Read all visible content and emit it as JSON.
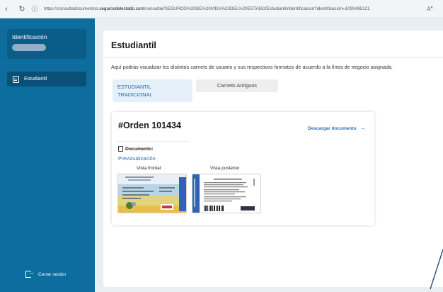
{
  "browser": {
    "url_prefix": "https://consultadocumentos.",
    "url_domain": "segurosdelestado.com",
    "url_path": "/consultar/SEGUROS%20DE%20VIDA%20DEL%20ESTADO/Estudiantil/identificacion?identificacion=1090485121"
  },
  "sidebar": {
    "identification_title": "Identificación",
    "items": [
      {
        "label": "Estudiantil"
      }
    ],
    "logout_label": "Cerrar sesión"
  },
  "main": {
    "title": "Estudiantil",
    "description": "Aquí podrás visualizar los distintos carnets de usuario y sus respectivos formatos de acuerdo a la línea de negocio asignada.",
    "tabs": [
      {
        "label_line1": "ESTUDIANTIL",
        "label_line2": "TRADICIONAL",
        "active": true
      },
      {
        "label": "Carnets Antiguos",
        "active": false
      }
    ],
    "order": {
      "number": "#Orden 101434",
      "download_label": "Descargar documento",
      "document_label": "Documento:",
      "preview_label": "Previzualización",
      "front_caption": "Vista frontal",
      "back_caption": "Vista posterior"
    }
  },
  "colors": {
    "sidebar": "#0c6d9e",
    "sidebar_active": "#0a4f75",
    "accent_link": "#2a6bb0",
    "tab_active_bg": "#e6f0fb"
  }
}
